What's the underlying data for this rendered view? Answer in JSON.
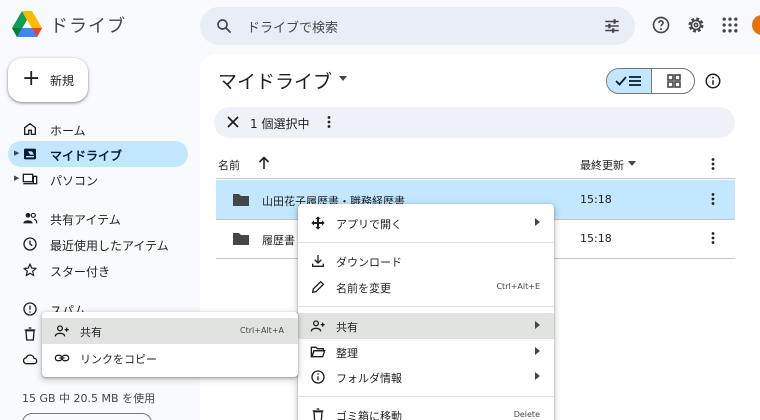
{
  "header": {
    "app_title": "ドライブ",
    "search_placeholder": "ドライブで検索"
  },
  "sidebar": {
    "new_label": "新規",
    "items": [
      {
        "label": "ホーム",
        "icon": "home-icon"
      },
      {
        "label": "マイドライブ",
        "icon": "drive-icon",
        "active": true
      },
      {
        "label": "パソコン",
        "icon": "computer-icon"
      },
      {
        "label": "共有アイテム",
        "icon": "people-icon"
      },
      {
        "label": "最近使用したアイテム",
        "icon": "clock-icon"
      },
      {
        "label": "スター付き",
        "icon": "star-icon"
      },
      {
        "label": "スパム",
        "icon": "report-icon"
      },
      {
        "label": "",
        "icon": "trash-icon"
      },
      {
        "label": "",
        "icon": "cloud-icon"
      }
    ],
    "storage_text": "15 GB 中 20.5 MB を使用"
  },
  "main": {
    "title": "マイドライブ",
    "selection_text": "1 個選択中",
    "columns": {
      "name": "名前",
      "modified": "最終更新"
    },
    "rows": [
      {
        "name": "山田花子履歴書・職務経歴書",
        "time": "15:18",
        "selected": true
      },
      {
        "name": "履歴書",
        "time": "15:18",
        "selected": false
      }
    ]
  },
  "context_menu": {
    "items": [
      {
        "label": "アプリで開く",
        "icon": "open-with-icon",
        "submenu": true
      },
      {
        "label": "ダウンロード",
        "icon": "download-icon"
      },
      {
        "label": "名前を変更",
        "icon": "edit-icon",
        "shortcut": "Ctrl+Alt+E"
      },
      {
        "label": "共有",
        "icon": "person-add-icon",
        "submenu": true,
        "highlighted": true
      },
      {
        "label": "整理",
        "icon": "folder-open-icon",
        "submenu": true
      },
      {
        "label": "フォルダ情報",
        "icon": "info-icon",
        "submenu": true
      },
      {
        "label": "ゴミ箱に移動",
        "icon": "trash-icon",
        "shortcut": "Delete"
      }
    ]
  },
  "share_submenu": {
    "items": [
      {
        "label": "共有",
        "icon": "person-add-icon",
        "shortcut": "Ctrl+Alt+A",
        "highlighted": true
      },
      {
        "label": "リンクをコピー",
        "icon": "link-icon"
      }
    ]
  },
  "colors": {
    "accent": "#c2e7ff",
    "background": "#f8fafd",
    "searchbar": "#e9eef6",
    "menu_highlight": "#e1e3e1"
  }
}
